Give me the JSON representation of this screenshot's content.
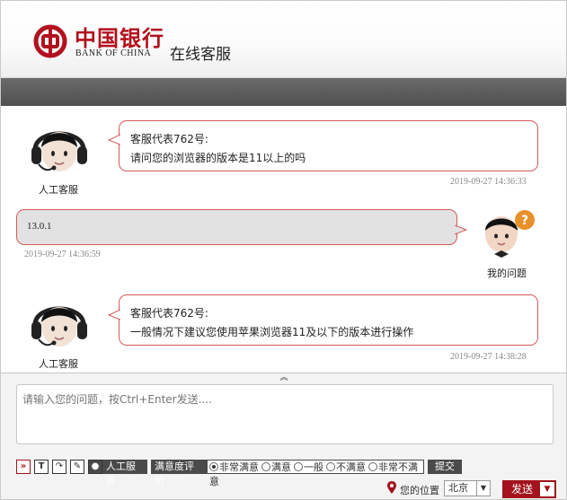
{
  "header": {
    "bank_name_cn": "中国银行",
    "bank_name_en": "BANK OF CHINA",
    "title": "在线客服"
  },
  "messages": [
    {
      "role": "agent",
      "avatar_label": "人工客服",
      "sender": "客服代表762号:",
      "text": "请问您的浏览器的版本是11以上的吗",
      "timestamp": "2019-09-27 14:36:33"
    },
    {
      "role": "user",
      "avatar_label": "我的问题",
      "text": "13.0.1",
      "timestamp": "2019-09-27 14:36:59"
    },
    {
      "role": "agent",
      "avatar_label": "人工客服",
      "sender": "客服代表762号:",
      "text": "一般情况下建议您使用苹果浏览器11及以下的版本进行操作",
      "timestamp": "2019-09-27 14:38:28"
    }
  ],
  "input": {
    "placeholder": "请输入您的问题，按Ctrl+Enter发送...."
  },
  "toolbar": {
    "human_service": "人工服务",
    "rating_label": "满意度评价",
    "rating_options": [
      "非常满意",
      "满意",
      "一般",
      "不满意",
      "非常不满意"
    ],
    "rating_selected": "非常满意",
    "submit": "提交"
  },
  "location": {
    "label": "您的位置",
    "city": "北京"
  },
  "send": {
    "label": "发送"
  },
  "colors": {
    "brand_red": "#b2111e",
    "bubble_border": "#d35a5a",
    "banner_gray": "#5c5c5c",
    "send_red": "#a3121d"
  }
}
